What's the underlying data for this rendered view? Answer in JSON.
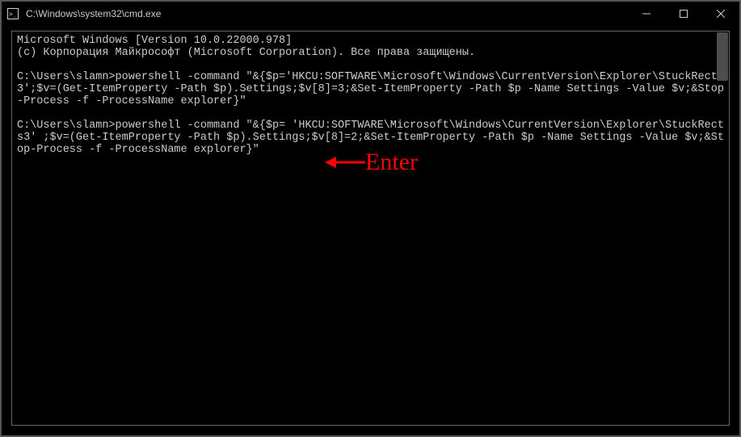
{
  "window": {
    "title": "C:\\Windows\\system32\\cmd.exe"
  },
  "terminal": {
    "line1": "Microsoft Windows [Version 10.0.22000.978]",
    "line2": "(c) Корпорация Майкрософт (Microsoft Corporation). Все права защищены.",
    "blank1": "",
    "prompt1": "C:\\Users\\slamn>powershell -command \"&{$p='HKCU:SOFTWARE\\Microsoft\\Windows\\CurrentVersion\\Explorer\\StuckRects3';$v=(Get-ItemProperty -Path $p).Settings;$v[8]=3;&Set-ItemProperty -Path $p -Name Settings -Value $v;&Stop-Process -f -ProcessName explorer}\"",
    "blank2": "",
    "prompt2": "C:\\Users\\slamn>powershell -command \"&{$p= 'HKCU:SOFTWARE\\Microsoft\\Windows\\CurrentVersion\\Explorer\\StuckRects3' ;$v=(Get-ItemProperty -Path $p).Settings;$v[8]=2;&Set-ItemProperty -Path $p -Name Settings -Value $v;&Stop-Process -f -ProcessName explorer}\""
  },
  "annotation": {
    "label": "Enter"
  }
}
